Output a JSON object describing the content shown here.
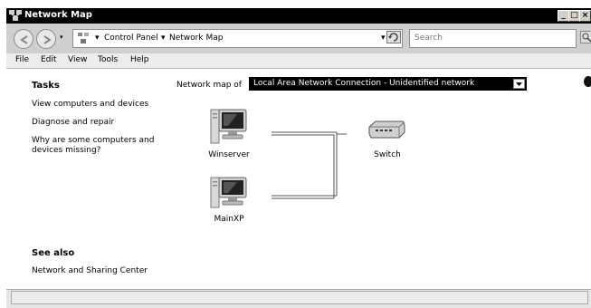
{
  "window": {
    "title": "Network Map"
  },
  "address": {
    "crumbs": [
      "Control Panel",
      "Network Map"
    ],
    "search_placeholder": "Search"
  },
  "menu": [
    "File",
    "Edit",
    "View",
    "Tools",
    "Help"
  ],
  "tasks": {
    "heading": "Tasks",
    "items": [
      "View computers and devices",
      "Diagnose and repair",
      "Why are some computers and devices missing?"
    ]
  },
  "see_also": {
    "heading": "See also",
    "items": [
      "Network and Sharing Center"
    ]
  },
  "network_map": {
    "label": "Network map of",
    "selected": "Local Area Network Connection - Unidentified network",
    "devices": [
      {
        "name": "Winserver",
        "icon": "computer-icon"
      },
      {
        "name": "MainXP",
        "icon": "computer-icon"
      },
      {
        "name": "Switch",
        "icon": "switch-icon"
      }
    ]
  }
}
